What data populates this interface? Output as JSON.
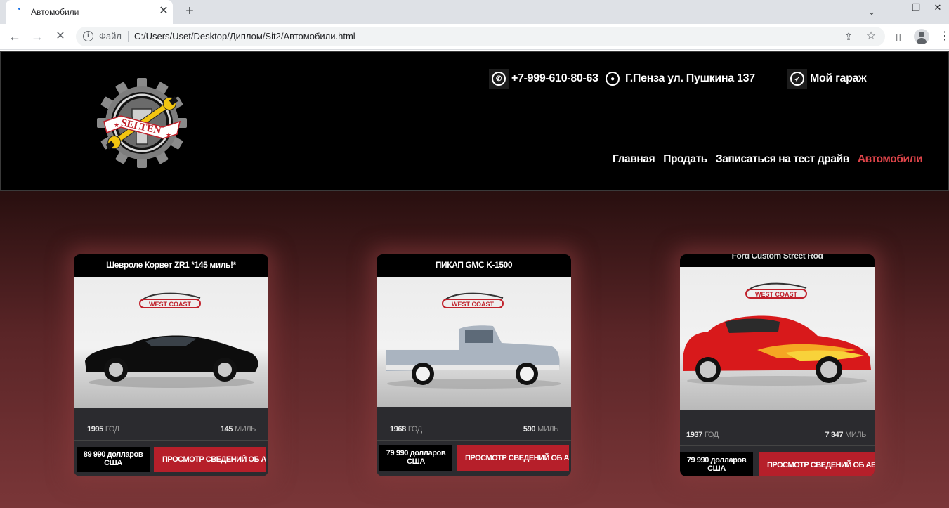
{
  "browser": {
    "tab_title": "Автомобили",
    "tab_close": "✕",
    "new_tab": "+",
    "tab_search": "⌄",
    "win_minimize": "—",
    "win_restore": "❐",
    "win_close": "✕",
    "back": "←",
    "forward": "→",
    "reload": "✕",
    "scheme_label": "Файл",
    "url": "C:/Users/Uset/Desktop/Диплом/Sit2/Автомобили.html",
    "share_icon": "⇪",
    "star_icon": "☆",
    "sidepanel_icon": "▯",
    "menu_icon": "⋮"
  },
  "header": {
    "logo_text": "SELTEN",
    "phone": "+7-999-610-80-63",
    "address": "Г.Пенза ул. Пушкина 137",
    "garage": "Мой гараж",
    "nav": [
      {
        "label": "Главная",
        "active": false
      },
      {
        "label": "Продать",
        "active": false
      },
      {
        "label": "Записаться на тест драйв",
        "active": false
      },
      {
        "label": "Автомобили",
        "active": true
      }
    ],
    "active_color": "#e0454a"
  },
  "cards": [
    {
      "title": "Шевроле Корвет ZR1 *145 миль!*",
      "year": "1995",
      "year_unit": "ГОД",
      "miles": "145",
      "miles_unit": "МИЛЬ",
      "price": "89 990 долларов США",
      "button": "ПРОСМОТР СВЕДЕНИЙ ОБ АВТОМОБИЛЕ",
      "dealer": "WEST COAST",
      "car_color": "#0d0d0d"
    },
    {
      "title": "ПИКАП GMC K-1500",
      "year": "1968",
      "year_unit": "ГОД",
      "miles": "590",
      "miles_unit": "МИЛЬ",
      "price": "79 990 долларов США",
      "button": "ПРОСМОТР СВЕДЕНИЙ ОБ АВТОМОБИЛЕ",
      "dealer": "WEST COAST",
      "car_color": "#aab4c0"
    },
    {
      "title": "Ford Custom Street Rod",
      "year": "1937",
      "year_unit": "ГОД",
      "miles": "7 347",
      "miles_unit": "МИЛЬ",
      "price": "79 990 долларов США",
      "button": "ПРОСМОТР СВЕДЕНИЙ ОБ АВТОМОБИЛЕ",
      "dealer": "WEST COAST",
      "car_color": "#d8191b"
    }
  ],
  "colors": {
    "button_red": "#b61f2a",
    "card_bg": "#2b2b2f"
  }
}
